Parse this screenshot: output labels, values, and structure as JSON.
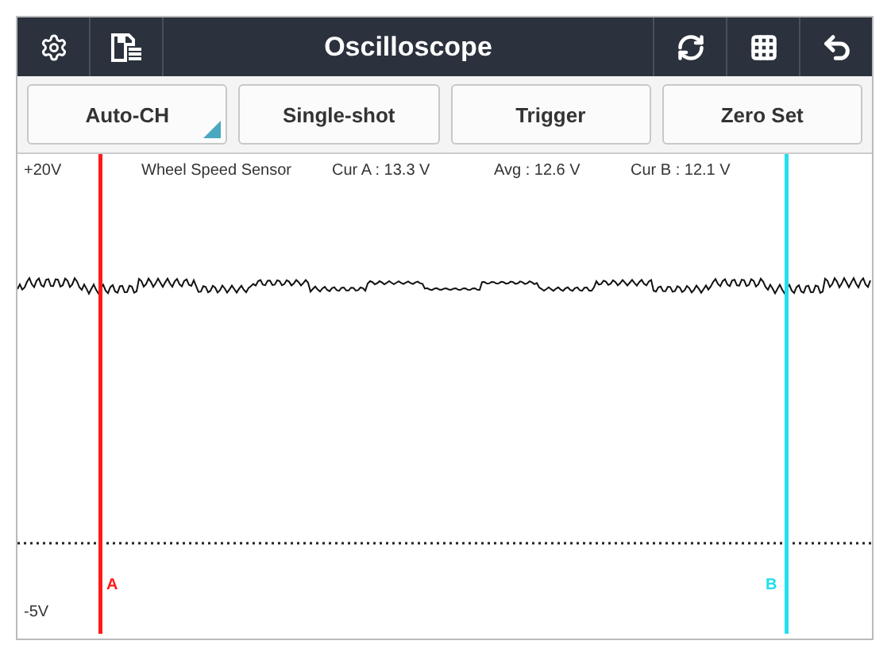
{
  "window": {
    "title": "Oscilloscope"
  },
  "toolbar": [
    {
      "label": "Auto-CH",
      "kind": "dropdown"
    },
    {
      "label": "Single-shot",
      "kind": "button"
    },
    {
      "label": "Trigger",
      "kind": "button"
    },
    {
      "label": "Zero Set",
      "kind": "button"
    }
  ],
  "plot": {
    "y_max": "+20V",
    "y_min": "-5V",
    "signal": "Wheel Speed Sensor",
    "readings": [
      "Cur A : 13.3 V",
      "Avg : 12.6 V",
      "Cur B : 12.1 V"
    ],
    "cursors": [
      {
        "label": "A",
        "color": "#ff1a1a"
      },
      {
        "label": "B",
        "color": "#22e0f0"
      }
    ]
  }
}
